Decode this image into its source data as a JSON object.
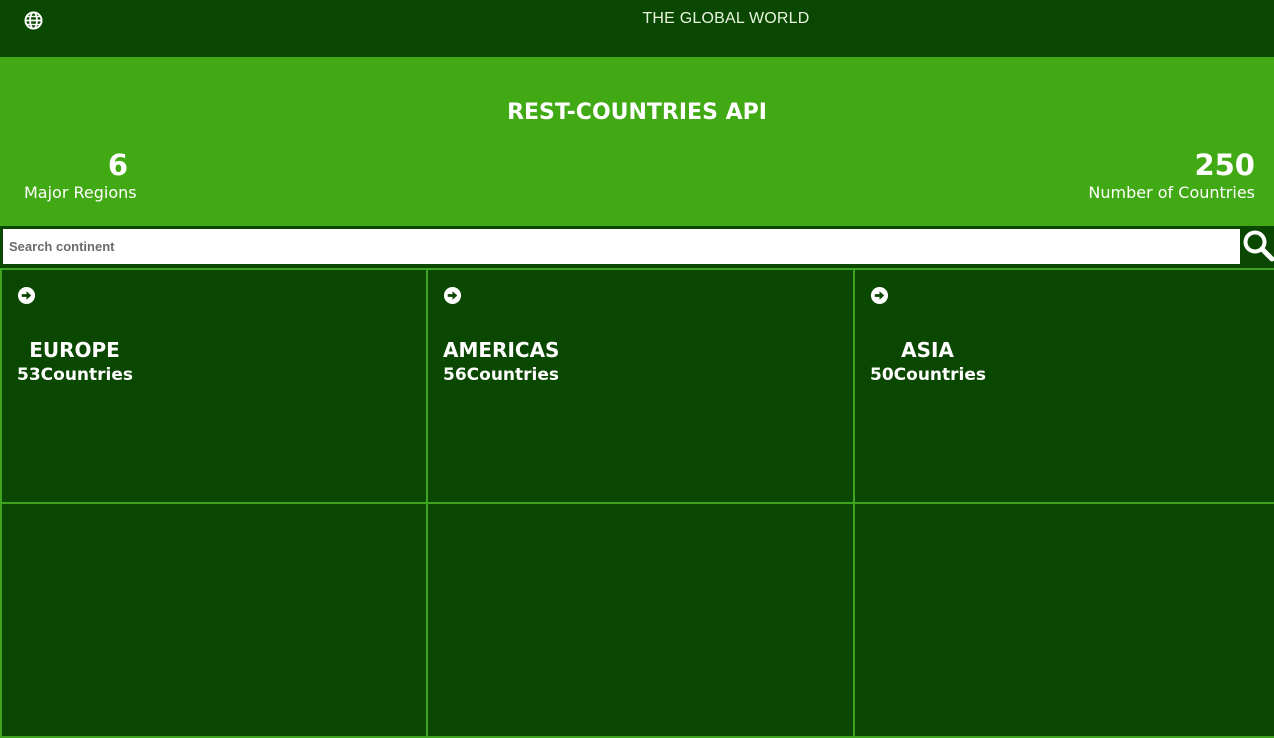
{
  "header": {
    "site_title": "THE GLOBAL WORLD",
    "logo_icon": "globe-icon"
  },
  "hero": {
    "title": "REST-COUNTRIES API",
    "regions": {
      "value": "6",
      "label": "Major Regions"
    },
    "countries": {
      "value": "250",
      "label": "Number of Countries"
    }
  },
  "search": {
    "placeholder": "Search continent",
    "value": "",
    "icon": "search-icon"
  },
  "regions": [
    {
      "name": "EUROPE",
      "count": "53Countries",
      "icon": "arrow-circle-right-icon"
    },
    {
      "name": "AMERICAS",
      "count": "56Countries",
      "icon": "arrow-circle-right-icon"
    },
    {
      "name": "ASIA",
      "count": "50Countries",
      "icon": "arrow-circle-right-icon"
    }
  ],
  "colors": {
    "dark_green": "#0a4700",
    "bright_green": "#40a913",
    "border_green": "#3ea320",
    "text": "#ffffff"
  }
}
